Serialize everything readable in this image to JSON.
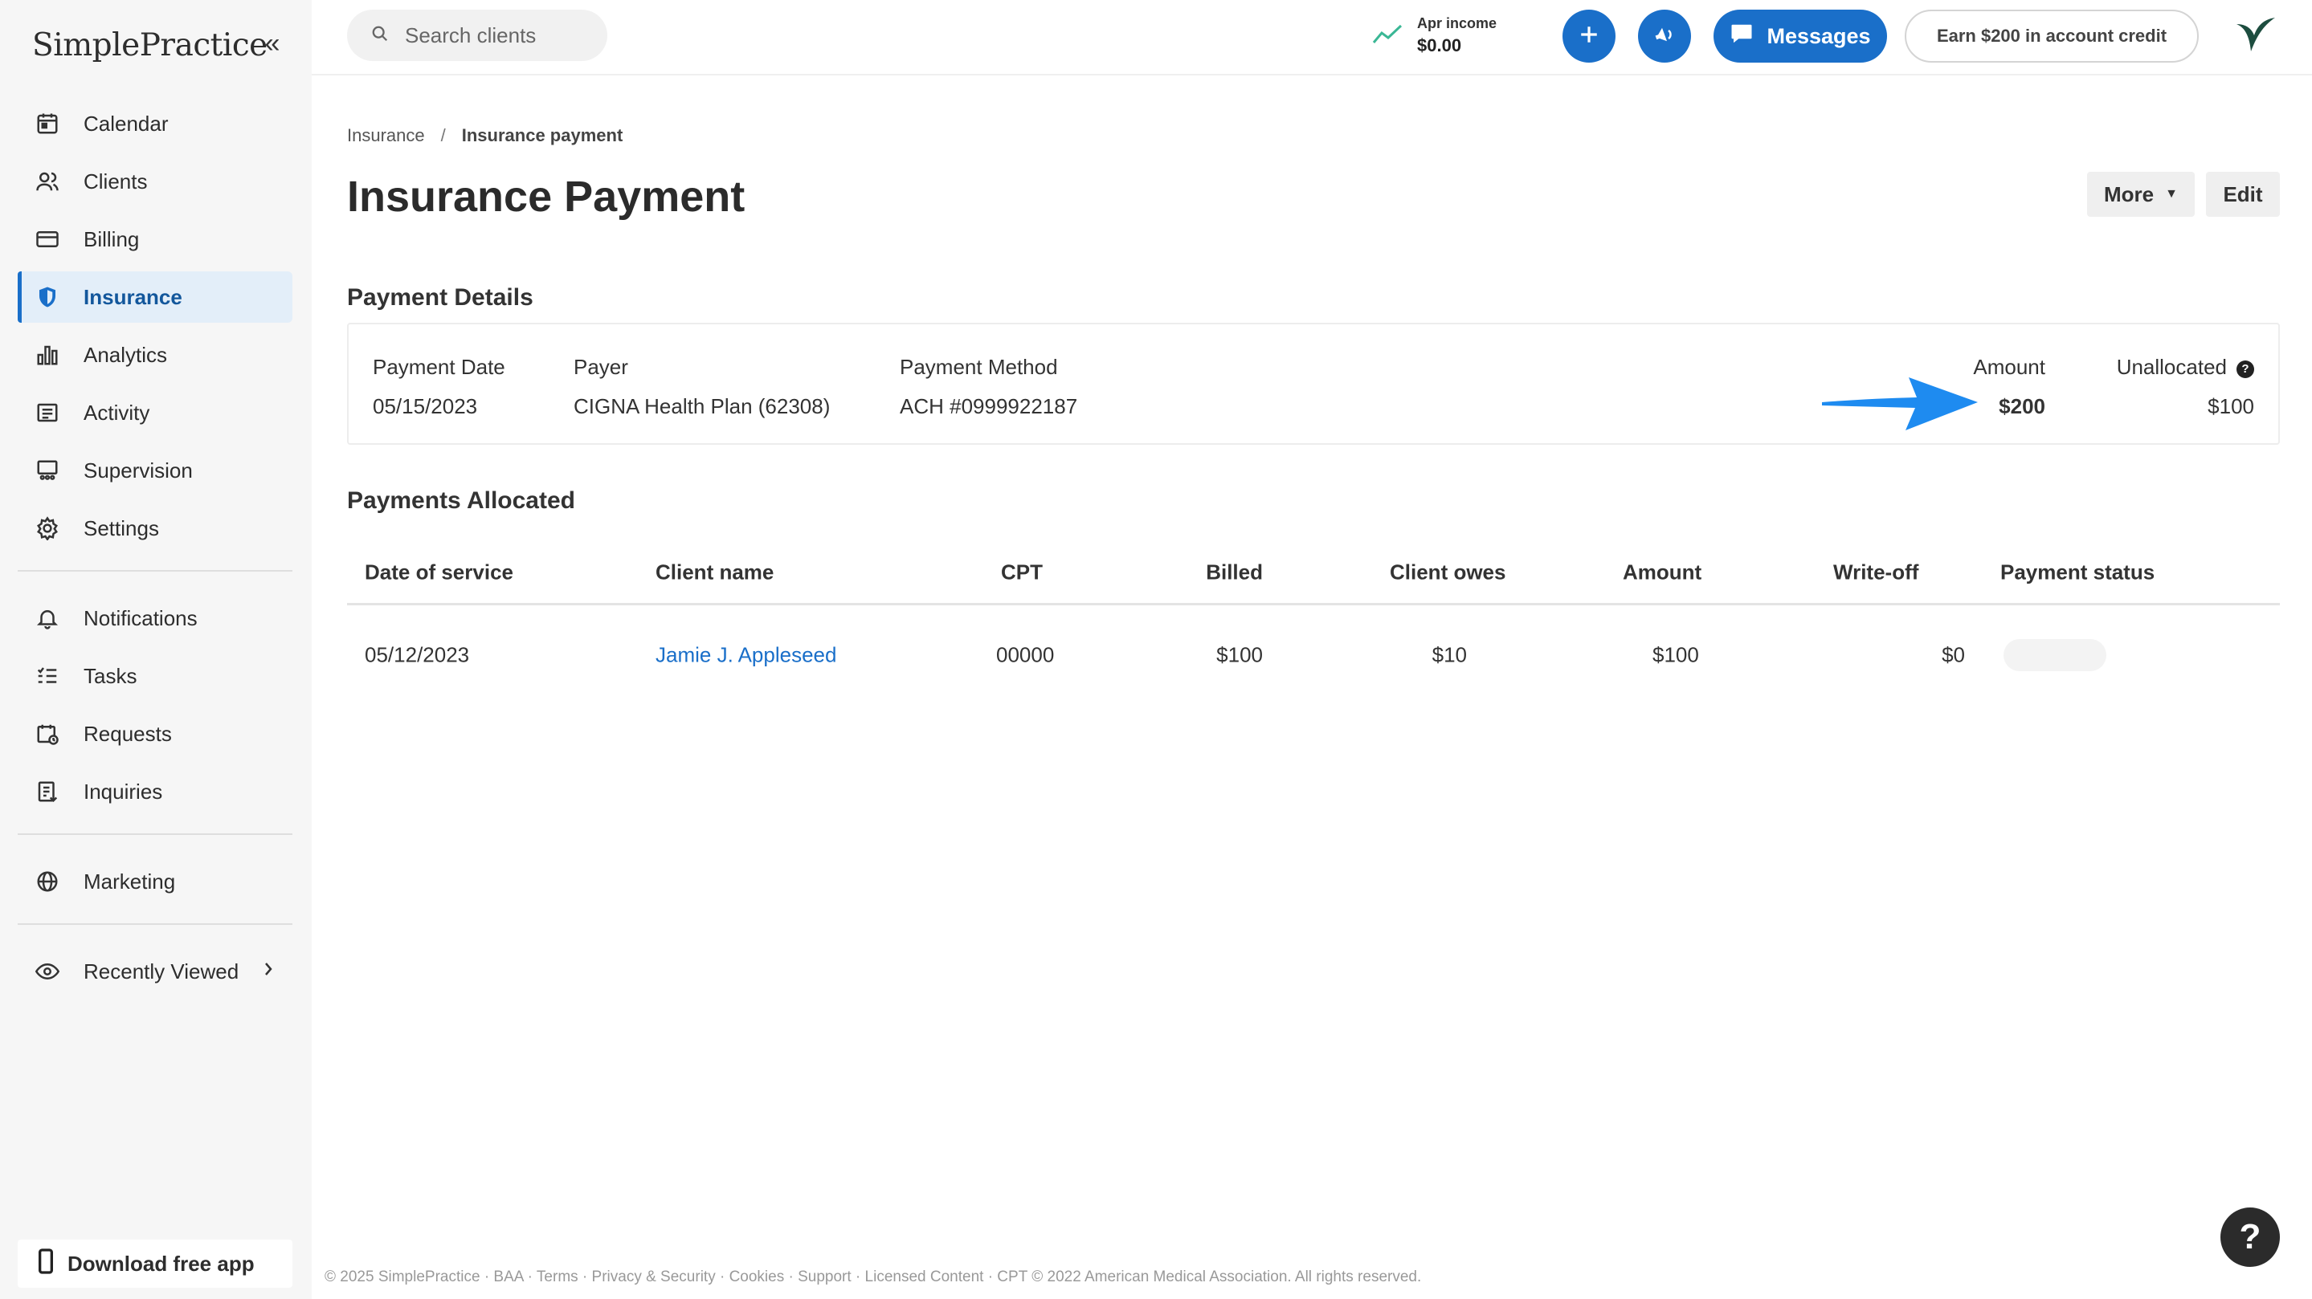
{
  "app": {
    "logo_text": "SimplePractice"
  },
  "sidebar": {
    "items": [
      {
        "label": "Calendar",
        "icon": "calendar-icon"
      },
      {
        "label": "Clients",
        "icon": "clients-icon"
      },
      {
        "label": "Billing",
        "icon": "billing-icon"
      },
      {
        "label": "Insurance",
        "icon": "shield-icon",
        "active": true
      },
      {
        "label": "Analytics",
        "icon": "analytics-icon"
      },
      {
        "label": "Activity",
        "icon": "activity-icon"
      },
      {
        "label": "Supervision",
        "icon": "supervision-icon"
      },
      {
        "label": "Settings",
        "icon": "gear-icon"
      }
    ],
    "items_group2": [
      {
        "label": "Notifications",
        "icon": "bell-icon"
      },
      {
        "label": "Tasks",
        "icon": "tasks-icon"
      },
      {
        "label": "Requests",
        "icon": "requests-icon"
      },
      {
        "label": "Inquiries",
        "icon": "inquiries-icon"
      }
    ],
    "items_group3": [
      {
        "label": "Marketing",
        "icon": "globe-icon"
      }
    ],
    "recently_viewed": "Recently Viewed",
    "download_app": "Download free app"
  },
  "topbar": {
    "search_placeholder": "Search clients",
    "income_label": "Apr income",
    "income_value": "$0.00",
    "messages_label": "Messages",
    "earn_label": "Earn $200 in account credit",
    "colors": {
      "accent": "#1a6fc9",
      "income_trend": "#3ab795"
    }
  },
  "page": {
    "breadcrumb_parent": "Insurance",
    "breadcrumb_sep": "/",
    "breadcrumb_current": "Insurance payment",
    "title": "Insurance Payment",
    "more_label": "More",
    "edit_label": "Edit"
  },
  "details": {
    "section_title": "Payment Details",
    "payment_date_label": "Payment Date",
    "payment_date": "05/15/2023",
    "payer_label": "Payer",
    "payer": "CIGNA Health Plan (62308)",
    "method_label": "Payment Method",
    "method": "ACH #0999922187",
    "amount_label": "Amount",
    "amount": "$200",
    "unallocated_label": "Unallocated",
    "unallocated": "$100"
  },
  "allocated": {
    "section_title": "Payments Allocated",
    "headers": {
      "date": "Date of service",
      "client": "Client name",
      "cpt": "CPT",
      "billed": "Billed",
      "owes": "Client owes",
      "amount": "Amount",
      "writeoff": "Write-off",
      "status": "Payment status"
    },
    "rows": [
      {
        "date": "05/12/2023",
        "client": "Jamie J. Appleseed",
        "cpt": "00000",
        "billed": "$100",
        "owes": "$10",
        "amount": "$100",
        "writeoff": "$0"
      }
    ]
  },
  "footer": {
    "text": "© 2025 SimplePractice · BAA · Terms · Privacy & Security · Cookies · Support · Licensed Content · CPT © 2022 American Medical Association. All rights reserved."
  },
  "help_fab": "?"
}
